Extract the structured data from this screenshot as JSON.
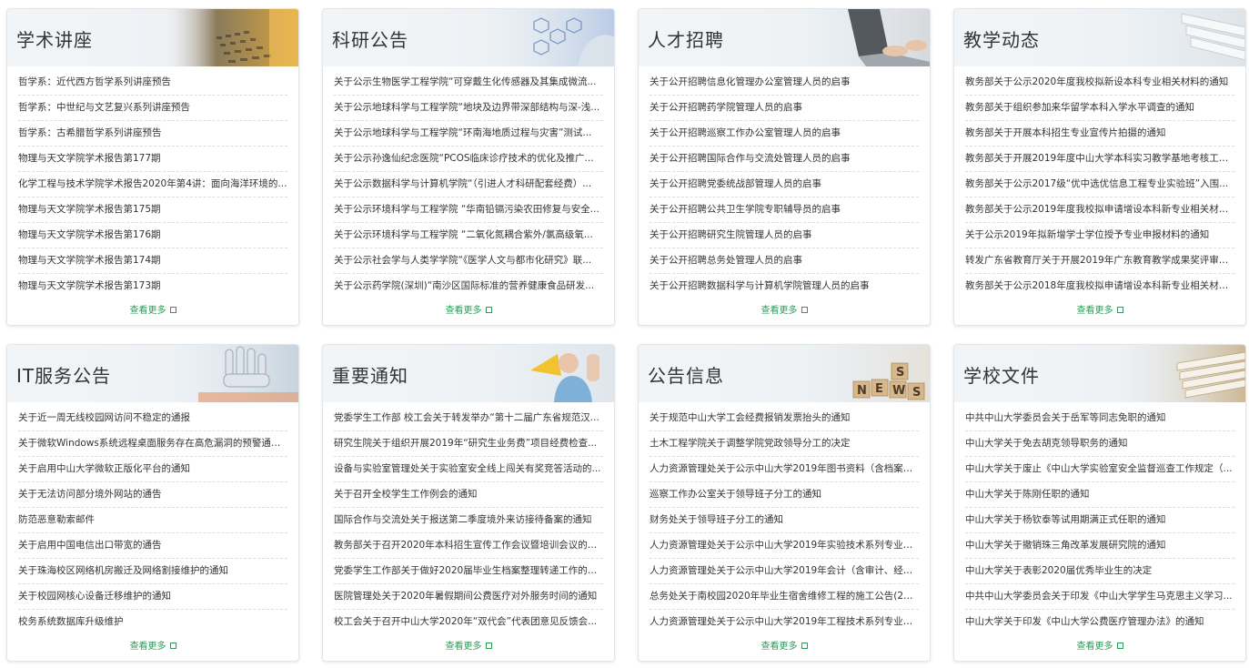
{
  "more_label": "查看更多",
  "colors": {
    "accent": "#2a9d58",
    "title": "#333333",
    "divider": "#d9dde0"
  },
  "cards": [
    {
      "title": "学术讲座",
      "items": [
        "哲学系：近代西方哲学系列讲座预告",
        "哲学系：中世纪与文艺复兴系列讲座预告",
        "哲学系：古希腊哲学系列讲座预告",
        "物理与天文学院学术报告第177期",
        "化学工程与技术学院学术报告2020年第4讲：面向海洋环境的...",
        "物理与天文学院学术报告第175期",
        "物理与天文学院学术报告第176期",
        "物理与天文学院学术报告第174期",
        "物理与天文学院学术报告第173期"
      ]
    },
    {
      "title": "科研公告",
      "items": [
        "关于公示生物医学工程学院“可穿戴生化传感器及其集成微流...",
        "关于公示地球科学与工程学院“地块及边界带深部结构与深-浅...",
        "关于公示地球科学与工程学院“环南海地质过程与灾害”测试...",
        "关于公示孙逸仙纪念医院“PCOS临床诊疗技术的优化及推广...",
        "关于公示数据科学与计算机学院“（引进人才科研配套经费）...",
        "关于公示环境科学与工程学院 “华南铅镉污染农田修复与安全...",
        "关于公示环境科学与工程学院 “二氧化氮耦合紫外/氯高级氧...",
        "关于公示社会学与人类学学院“《医学人文与都市化研究》联...",
        "关于公示药学院(深圳)“南沙区国际标准的营养健康食品研发..."
      ]
    },
    {
      "title": "人才招聘",
      "items": [
        "关于公开招聘信息化管理办公室管理人员的启事",
        "关于公开招聘药学院管理人员的启事",
        "关于公开招聘巡察工作办公室管理人员的启事",
        "关于公开招聘国际合作与交流处管理人员的启事",
        "关于公开招聘党委统战部管理人员的启事",
        "关于公开招聘公共卫生学院专职辅导员的启事",
        "关于公开招聘研究生院管理人员的启事",
        "关于公开招聘总务处管理人员的启事",
        "关于公开招聘数据科学与计算机学院管理人员的启事"
      ]
    },
    {
      "title": "教学动态",
      "items": [
        "教务部关于公示2020年度我校拟新设本科专业相关材料的通知",
        "教务部关于组织参加来华留学本科入学水平调查的通知",
        "教务部关于开展本科招生专业宣传片拍摄的通知",
        "教务部关于开展2019年度中山大学本科实习教学基地考核工作...",
        "教务部关于公示2017级“优中选优信息工程专业实验班”入围...",
        "教务部关于公示2019年度我校拟申请增设本科新专业相关材料...",
        "关于公示2019年拟新增学士学位授予专业申报材料的通知",
        "转发广东省教育厅关于开展2019年广东教育教学成果奖评审工...",
        "教务部关于公示2018年度我校拟申请增设本科新专业相关材料..."
      ]
    },
    {
      "title": "IT服务公告",
      "items": [
        "关于近一周无线校园网访问不稳定的通报",
        "关于微软Windows系统远程桌面服务存在高危漏洞的预警通报...",
        "关于启用中山大学微软正版化平台的通知",
        "关于无法访问部分境外网站的通告",
        "防范恶意勒索邮件",
        "关于启用中国电信出口带宽的通告",
        "关于珠海校区网络机房搬迁及网络割接维护的通知",
        "关于校园网核心设备迁移维护的通知",
        "校务系统数据库升级维护"
      ]
    },
    {
      "title": "重要通知",
      "items": [
        "党委学生工作部 校工会关于转发举办“第十二届广东省规范汉...",
        "研究生院关于组织开展2019年“研究生业务费”项目经费检查...",
        "设备与实验室管理处关于实验室安全线上闯关有奖竞答活动的...",
        "关于召开全校学生工作例会的通知",
        "国际合作与交流处关于报送第二季度境外来访接待备案的通知",
        "教务部关于召开2020年本科招生宣传工作会议暨培训会议的通知",
        "党委学生工作部关于做好2020届毕业生档案整理转递工作的通知",
        "医院管理处关于2020年暑假期间公费医疗对外服务时间的通知",
        "校工会关于召开中山大学2020年“双代会”代表团意见反馈会..."
      ]
    },
    {
      "title": "公告信息",
      "items": [
        "关于规范中山大学工会经费报销发票抬头的通知",
        "土木工程学院关于调整学院党政领导分工的决定",
        "人力资源管理处关于公示中山大学2019年图书资料（含档案、...",
        "巡察工作办公室关于领导班子分工的通知",
        "财务处关于领导班子分工的通知",
        "人力资源管理处关于公示中山大学2019年实验技术系列专业技...",
        "人力资源管理处关于公示中山大学2019年会计（含审计、经济...",
        "总务处关于南校园2020年毕业生宿舍维修工程的施工公告(202...",
        "人力资源管理处关于公示中山大学2019年工程技术系列专业技..."
      ]
    },
    {
      "title": "学校文件",
      "items": [
        "中共中山大学委员会关于岳军等同志免职的通知",
        "中山大学关于免去胡克领导职务的通知",
        "中山大学关于废止《中山大学实验室安全监督巡查工作规定（...",
        "中山大学关于陈刚任职的通知",
        "中山大学关于杨钦泰等试用期满正式任职的通知",
        "中山大学关于撤销珠三角改革发展研究院的通知",
        "中山大学关于表彰2020届优秀毕业生的决定",
        "中共中山大学委员会关于印发《中山大学学生马克思主义学习...",
        "中山大学关于印发《中山大学公费医疗管理办法》的通知"
      ]
    }
  ]
}
